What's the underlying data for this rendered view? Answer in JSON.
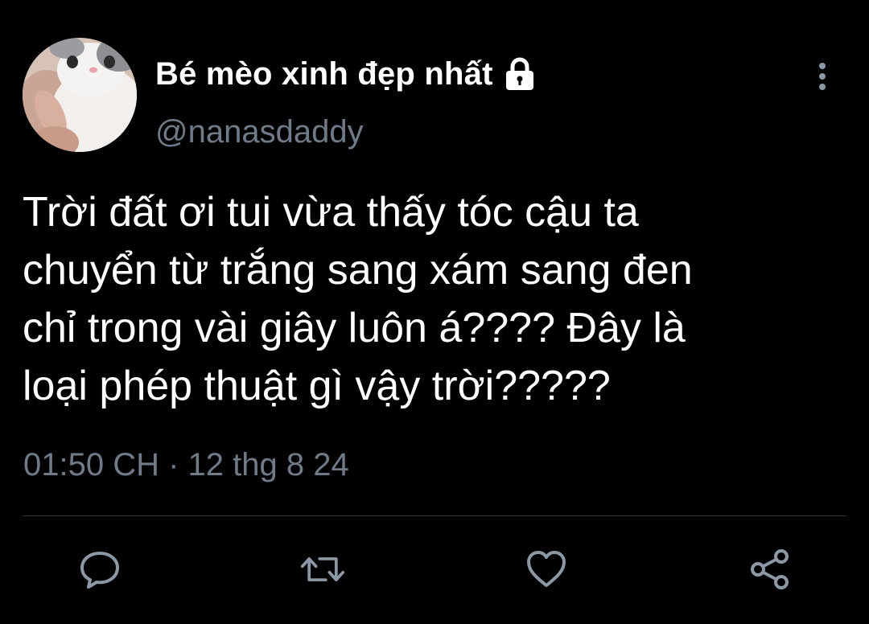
{
  "user": {
    "display_name": "Bé mèo xinh đẹp nhất",
    "handle": "@nanasdaddy",
    "avatar_icon": "cat-avatar",
    "protected_icon": "lock-icon"
  },
  "tweet": {
    "text": "Trời đất ơi tui vừa thấy tóc cậu ta\nchuyển từ trắng sang xám sang đen\nchỉ trong vài giây luôn á???? Đây là\nloại phép thuật gì vậy trời?????",
    "timestamp": "01:50 CH · 12 thg 8 24"
  },
  "actions": [
    {
      "icon": "reply-icon"
    },
    {
      "icon": "retweet-icon"
    },
    {
      "icon": "like-icon"
    },
    {
      "icon": "share-icon"
    }
  ],
  "colors": {
    "background": "#000000",
    "text": "#ffffff",
    "secondary_text": "#6e7b88",
    "icon": "#8b98a5",
    "divider": "#2f3336"
  }
}
